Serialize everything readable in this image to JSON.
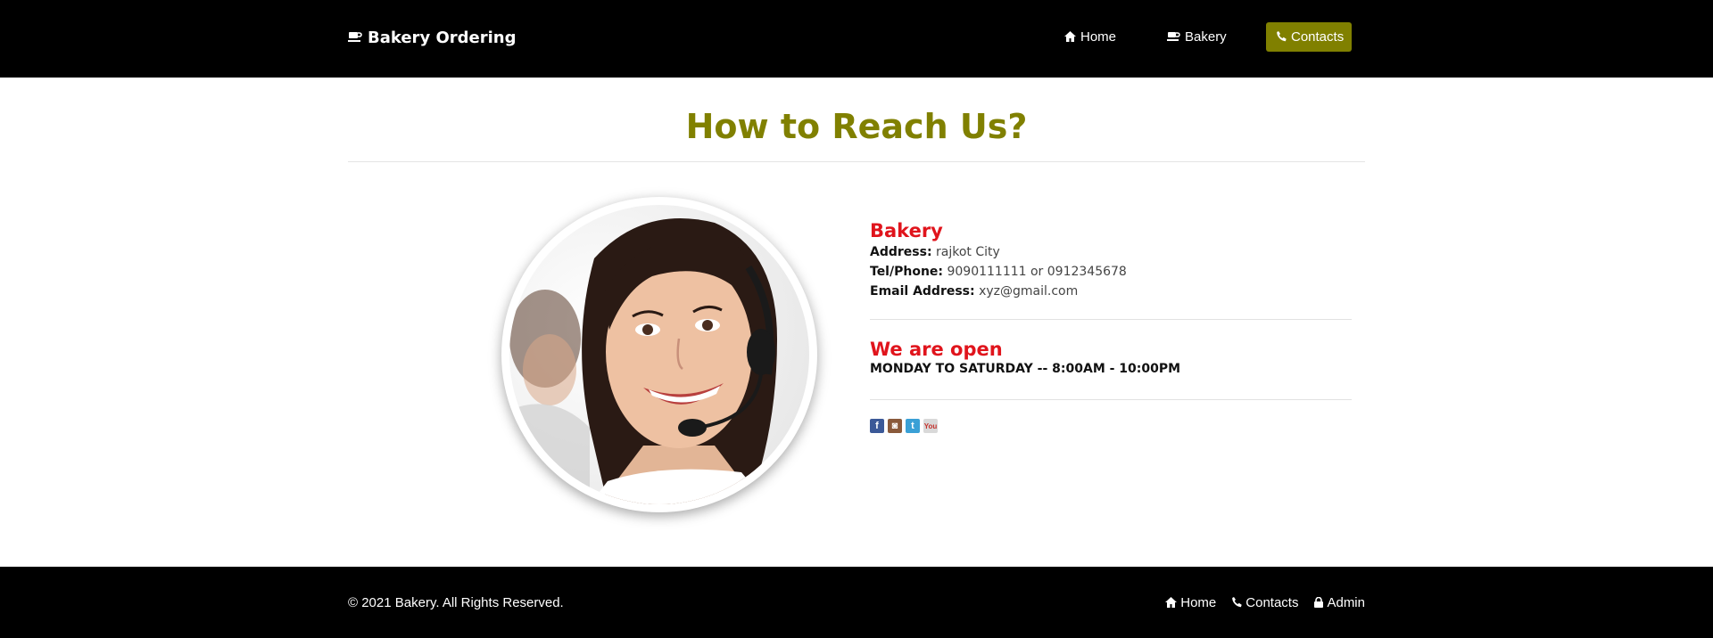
{
  "navbar": {
    "brand_icon": "coffee-cup-icon",
    "brand": "Bakery Ordering",
    "items": [
      {
        "icon": "home-icon",
        "label": "Home"
      },
      {
        "icon": "coffee-cup-icon",
        "label": "Bakery"
      },
      {
        "icon": "phone-icon",
        "label": "Contacts",
        "active": true
      }
    ],
    "active_color": "#808000"
  },
  "page": {
    "title": "How to Reach Us?",
    "title_color": "#808000",
    "portrait": "customer-support-agent-photo"
  },
  "contact": {
    "name": "Bakery",
    "name_color": "#e0141c",
    "address_label": "Address:",
    "address": "rajkot City",
    "phone_label": "Tel/Phone:",
    "phone": "9090111111 or 0912345678",
    "email_label": "Email Address:",
    "email": "xyz@gmail.com"
  },
  "hours": {
    "title": "We are open",
    "text": "MONDAY TO SATURDAY -- 8:00AM - 10:00PM"
  },
  "socials": [
    {
      "icon": "facebook-icon",
      "glyph": "f"
    },
    {
      "icon": "instagram-icon",
      "glyph": "◙"
    },
    {
      "icon": "twitter-icon",
      "glyph": "t"
    },
    {
      "icon": "youtube-icon",
      "glyph": "You"
    }
  ],
  "footer": {
    "copyright": "© 2021 Bakery. All Rights Reserved.",
    "links": [
      {
        "icon": "home-icon",
        "label": "Home"
      },
      {
        "icon": "phone-icon",
        "label": "Contacts"
      },
      {
        "icon": "lock-icon",
        "label": "Admin"
      }
    ]
  }
}
